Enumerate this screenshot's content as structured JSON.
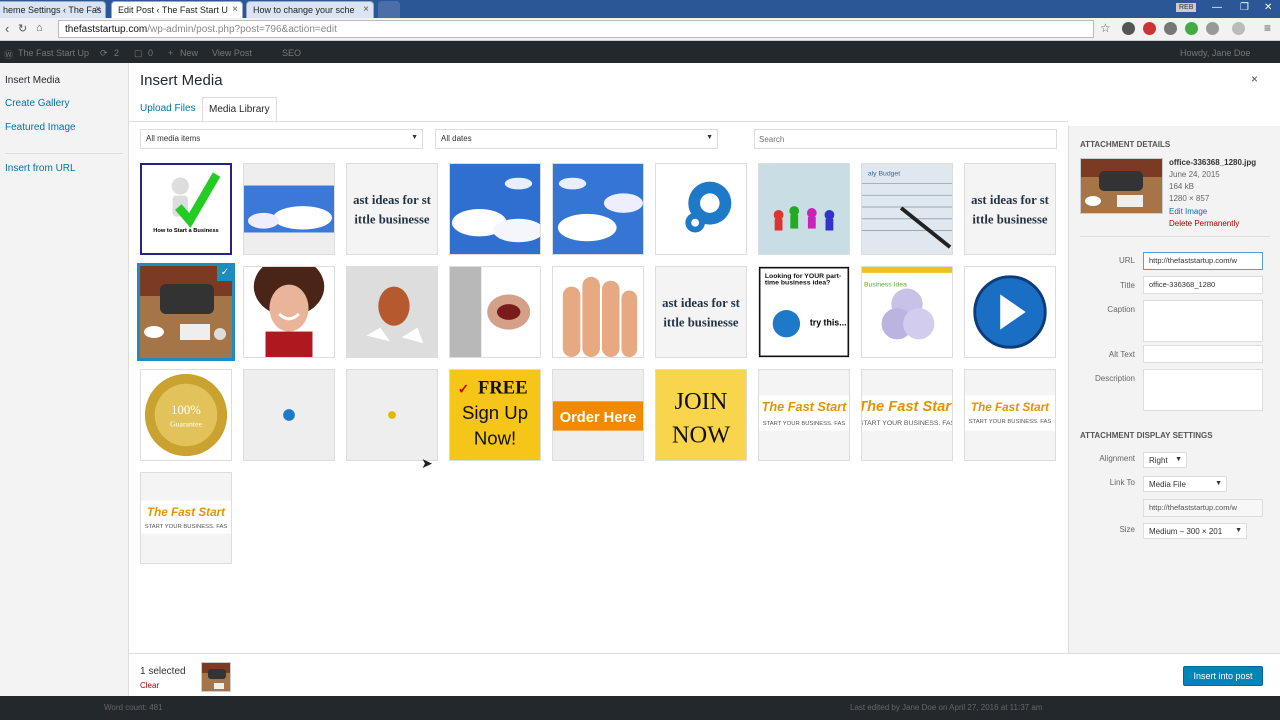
{
  "browser": {
    "tabs": [
      {
        "label": "heme Settings ‹ The Fas",
        "active": false
      },
      {
        "label": "Edit Post ‹ The Fast Start U",
        "active": true
      },
      {
        "label": "How to change your sche",
        "active": false
      }
    ],
    "user_badge": "REB",
    "url_domain": "thefaststartup.com",
    "url_path": "/wp-admin/post.php?post=796&action=edit"
  },
  "adminbar": {
    "site": "The Fast Start Up",
    "updates": "2",
    "comments": "0",
    "new": "New",
    "view": "View Post",
    "seo": "SEO",
    "howdy": "Howdy, Jane Doe"
  },
  "menu": {
    "insert_media": "Insert Media",
    "create_gallery": "Create Gallery",
    "featured_image": "Featured Image",
    "insert_url": "Insert from URL"
  },
  "frame": {
    "title": "Insert Media",
    "close": "×",
    "tab_upload": "Upload Files",
    "tab_library": "Media Library"
  },
  "filters": {
    "type": "All media items",
    "date": "All dates",
    "search_placeholder": "Search"
  },
  "thumbs": {
    "fast_ideas_1": "ast ideas for st",
    "fast_ideas_2": "ittle businesse",
    "looking": "Looking for YOUR part-time business idea?",
    "try": "try this...",
    "business_idea": "Business Idea",
    "guarantee_1": "100%",
    "guarantee_2": "Guarantee",
    "free": "FREE",
    "signup": "Sign Up",
    "now": "Now!",
    "order": "Order Here",
    "join": "JOIN",
    "join_now": "NOW",
    "fast_start": "The Fast Start",
    "start_your": "START YOUR BUSINESS. FAS",
    "howto": "How to Start a Business",
    "budget": "aly Budget"
  },
  "details": {
    "heading": "Attachment Details",
    "filename": "office-336368_1280.jpg",
    "date": "June 24, 2015",
    "size": "164 kB",
    "dimensions": "1280 × 857",
    "edit": "Edit Image",
    "delete": "Delete Permanently",
    "url_label": "URL",
    "url_value": "http://thefaststartup.com/w",
    "title_label": "Title",
    "title_value": "office-336368_1280",
    "caption_label": "Caption",
    "alt_label": "Alt Text",
    "desc_label": "Description"
  },
  "display": {
    "heading": "Attachment Display Settings",
    "align_label": "Alignment",
    "align_value": "Right",
    "link_label": "Link To",
    "link_value": "Media File",
    "link_url": "http://thefaststartup.com/w",
    "size_label": "Size",
    "size_value": "Medium – 300 × 201"
  },
  "toolbar": {
    "selected": "1 selected",
    "clear": "Clear",
    "insert": "Insert into post"
  },
  "status": {
    "words": "Word count: 481",
    "last_edited": "Last edited by Jane Doe on April 27, 2016 at 11:37 am"
  },
  "colors": {
    "accent": "#0085ba",
    "link": "#0073aa",
    "danger": "#a00",
    "selected_border": "#1e8cbe"
  }
}
